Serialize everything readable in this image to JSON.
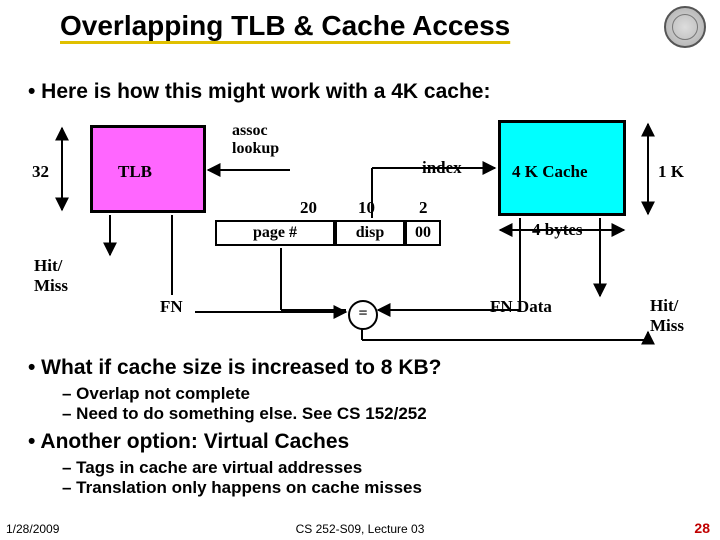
{
  "title": "Overlapping TLB & Cache Access",
  "bullets": {
    "b1": "• Here is how this might work with a 4K cache:",
    "b2": "• What if cache size is increased to 8 KB?",
    "b2d1": "– Overlap not complete",
    "b2d2": "– Need to do something else.  See CS 152/252",
    "b3": "• Another option: Virtual Caches",
    "b3d1": "– Tags in cache are virtual addresses",
    "b3d2": "– Translation only happens on cache misses"
  },
  "diagram": {
    "tlb_label": "TLB",
    "tlb_bits": "32",
    "assoc_label_l1": "assoc",
    "assoc_label_l2": "lookup",
    "hit_miss_left_l1": "Hit/",
    "hit_miss_left_l2": "Miss",
    "fn_label": "FN",
    "addr_bits_tag": "20",
    "addr_bits_index": "10",
    "addr_bits_off": "2",
    "addr_lbl_tag": "page #",
    "addr_lbl_index": "disp",
    "addr_lbl_off": "00",
    "index_label": "index",
    "cache_label": "4 K Cache",
    "cache_height": "1 K",
    "cache_width": "4 bytes",
    "eq": "=",
    "fn_data": "FN  Data",
    "hit_miss_right_l1": "Hit/",
    "hit_miss_right_l2": "Miss"
  },
  "footer": {
    "date": "1/28/2009",
    "mid": "CS 252-S09, Lecture 03",
    "page": "28"
  }
}
